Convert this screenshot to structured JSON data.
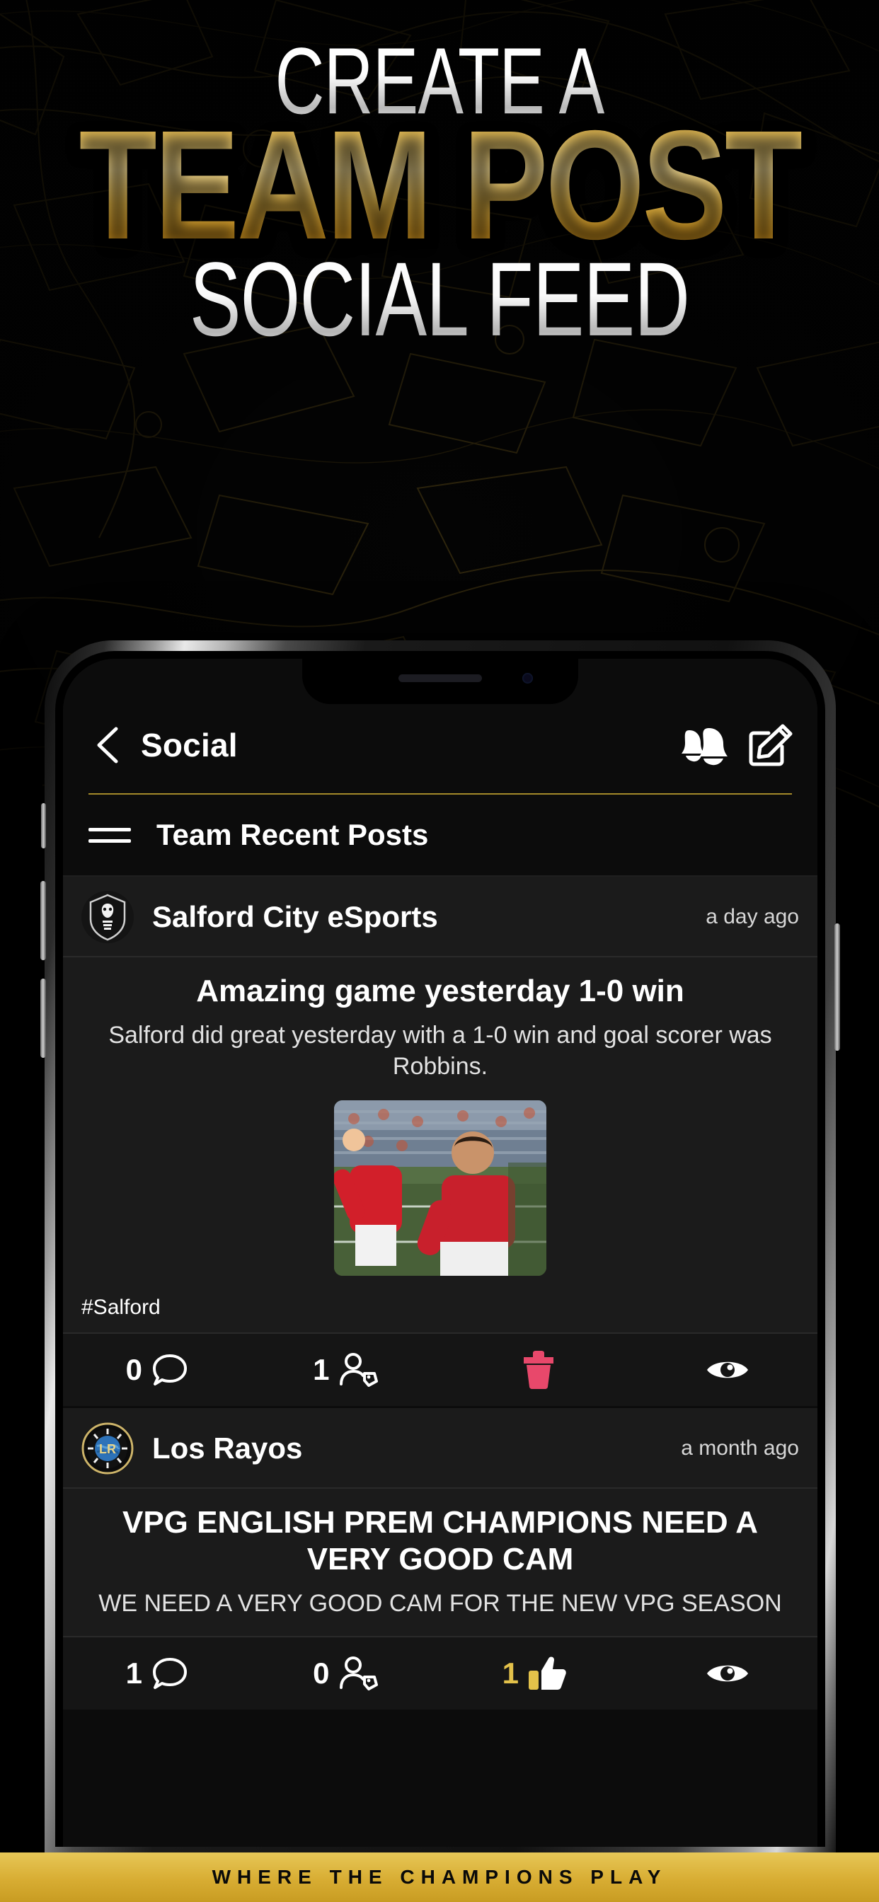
{
  "hero": {
    "line1": "CREATE A",
    "line2": "TEAM POST",
    "line3": "SOCIAL FEED"
  },
  "colors": {
    "gold": "#d8ad33",
    "gold_rule": "#a48a2a",
    "trash_pink": "#e8486b",
    "card_bg": "#1b1b1b",
    "app_bg": "#0c0c0c",
    "gold_count": "#e3c14a"
  },
  "navbar": {
    "back_icon": "chevron-left-icon",
    "title": "Social",
    "notifications_icon": "bells-icon",
    "compose_icon": "compose-square-pencil-icon"
  },
  "section": {
    "menu_icon": "hamburger-menu-icon",
    "title": "Team Recent Posts"
  },
  "posts": [
    {
      "avatar_icon": "salford-city-crest-icon",
      "team": "Salford City eSports",
      "time": "a day ago",
      "title": "Amazing game yesterday 1-0 win",
      "body": "Salford did great yesterday with a 1-0 win and goal scorer was Robbins.",
      "media_icon": "football-match-photo",
      "tag": "#Salford",
      "actions": [
        {
          "icon": "comment-bubble-icon",
          "count": "0",
          "gold": false
        },
        {
          "icon": "user-tag-icon",
          "count": "1",
          "gold": false
        },
        {
          "icon": "trash-icon",
          "count": "",
          "gold": false
        },
        {
          "icon": "eye-icon",
          "count": "",
          "gold": false
        }
      ]
    },
    {
      "avatar_icon": "los-rayos-crest-icon",
      "team": "Los Rayos",
      "time": "a month ago",
      "title": "VPG ENGLISH PREM CHAMPIONS NEED A VERY GOOD CAM",
      "body": "WE NEED A VERY GOOD CAM FOR THE NEW VPG SEASON",
      "tag": "",
      "actions": [
        {
          "icon": "comment-bubble-icon",
          "count": "1",
          "gold": false
        },
        {
          "icon": "user-tag-icon",
          "count": "0",
          "gold": false
        },
        {
          "icon": "thumbs-up-icon",
          "count": "1",
          "gold": true
        },
        {
          "icon": "eye-icon",
          "count": "",
          "gold": false
        }
      ]
    }
  ],
  "footer": {
    "text": "WHERE THE CHAMPIONS PLAY"
  }
}
